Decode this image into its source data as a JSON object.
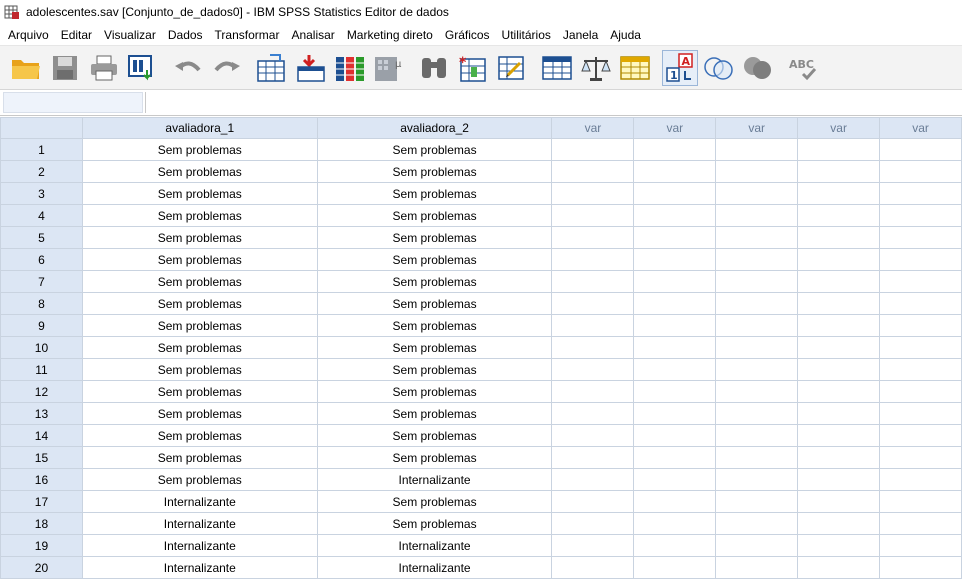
{
  "window": {
    "title": "adolescentes.sav [Conjunto_de_dados0] - IBM SPSS Statistics Editor de dados"
  },
  "menu": [
    {
      "label": "Arquivo",
      "name": "menu-arquivo"
    },
    {
      "label": "Editar",
      "name": "menu-editar"
    },
    {
      "label": "Visualizar",
      "name": "menu-visualizar"
    },
    {
      "label": "Dados",
      "name": "menu-dados"
    },
    {
      "label": "Transformar",
      "name": "menu-transformar"
    },
    {
      "label": "Analisar",
      "name": "menu-analisar"
    },
    {
      "label": "Marketing direto",
      "name": "menu-marketing-direto"
    },
    {
      "label": "Gráficos",
      "name": "menu-graficos"
    },
    {
      "label": "Utilitários",
      "name": "menu-utilitarios"
    },
    {
      "label": "Janela",
      "name": "menu-janela"
    },
    {
      "label": "Ajuda",
      "name": "menu-ajuda"
    }
  ],
  "toolbar_icons": [
    "open-folder-icon",
    "save-icon",
    "print-icon",
    "dialog-recall-icon",
    "undo-icon",
    "redo-icon",
    "goto-case-icon",
    "goto-variable-icon",
    "variables-icon",
    "run-descriptives-icon",
    "find-icon",
    "insert-cases-icon",
    "insert-variable-icon",
    "split-file-icon",
    "weight-cases-icon",
    "select-cases-icon",
    "value-labels-icon",
    "use-variable-sets-icon",
    "show-all-variables-icon",
    "spell-check-icon"
  ],
  "grid": {
    "columns": [
      "avaliadora_1",
      "avaliadora_2",
      "var",
      "var",
      "var",
      "var",
      "var"
    ],
    "rows": [
      {
        "n": "1",
        "a": "Sem problemas",
        "b": "Sem problemas"
      },
      {
        "n": "2",
        "a": "Sem problemas",
        "b": "Sem problemas"
      },
      {
        "n": "3",
        "a": "Sem problemas",
        "b": "Sem problemas"
      },
      {
        "n": "4",
        "a": "Sem problemas",
        "b": "Sem problemas"
      },
      {
        "n": "5",
        "a": "Sem problemas",
        "b": "Sem problemas"
      },
      {
        "n": "6",
        "a": "Sem problemas",
        "b": "Sem problemas"
      },
      {
        "n": "7",
        "a": "Sem problemas",
        "b": "Sem problemas"
      },
      {
        "n": "8",
        "a": "Sem problemas",
        "b": "Sem problemas"
      },
      {
        "n": "9",
        "a": "Sem problemas",
        "b": "Sem problemas"
      },
      {
        "n": "10",
        "a": "Sem problemas",
        "b": "Sem problemas"
      },
      {
        "n": "11",
        "a": "Sem problemas",
        "b": "Sem problemas"
      },
      {
        "n": "12",
        "a": "Sem problemas",
        "b": "Sem problemas"
      },
      {
        "n": "13",
        "a": "Sem problemas",
        "b": "Sem problemas"
      },
      {
        "n": "14",
        "a": "Sem problemas",
        "b": "Sem problemas"
      },
      {
        "n": "15",
        "a": "Sem problemas",
        "b": "Sem problemas"
      },
      {
        "n": "16",
        "a": "Sem problemas",
        "b": "Internalizante"
      },
      {
        "n": "17",
        "a": "Internalizante",
        "b": "Sem problemas"
      },
      {
        "n": "18",
        "a": "Internalizante",
        "b": "Sem problemas"
      },
      {
        "n": "19",
        "a": "Internalizante",
        "b": "Internalizante"
      },
      {
        "n": "20",
        "a": "Internalizante",
        "b": "Internalizante"
      }
    ]
  }
}
